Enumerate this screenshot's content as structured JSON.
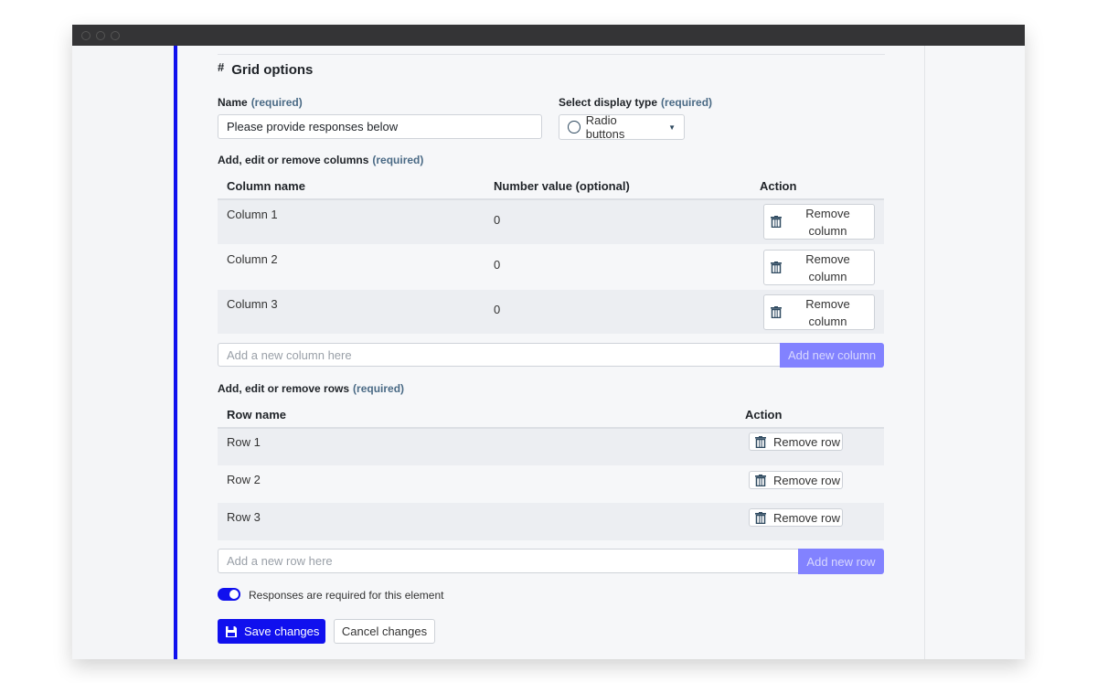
{
  "section": {
    "title": "Grid options",
    "icon": "hash-icon"
  },
  "name_field": {
    "label": "Name",
    "required": "(required)",
    "value": "Please provide responses below"
  },
  "display_type": {
    "label": "Select display type",
    "required": "(required)",
    "value": "Radio buttons"
  },
  "columns": {
    "label": "Add, edit or remove columns",
    "required": "(required)",
    "headers": [
      "Column name",
      "Number value (optional)",
      "Action"
    ],
    "rows": [
      {
        "name": "Column 1",
        "value": "0"
      },
      {
        "name": "Column 2",
        "value": "0"
      },
      {
        "name": "Column 3",
        "value": "0"
      }
    ],
    "remove_label_1": "Remove",
    "remove_label_2": "column",
    "add_placeholder": "Add a new column here",
    "add_button": "Add new column"
  },
  "rows": {
    "label": "Add, edit or remove rows",
    "required": "(required)",
    "headers": [
      "Row name",
      "Action"
    ],
    "rows": [
      {
        "name": "Row 1"
      },
      {
        "name": "Row 2"
      },
      {
        "name": "Row 3"
      }
    ],
    "remove_label": "Remove row",
    "add_placeholder": "Add a new row here",
    "add_button": "Add new row"
  },
  "required_toggle": {
    "label": "Responses are required for this element",
    "on": true
  },
  "actions": {
    "save": "Save changes",
    "cancel": "Cancel changes"
  },
  "colors": {
    "accent": "#1010ee",
    "add_button": "#8282ff"
  }
}
